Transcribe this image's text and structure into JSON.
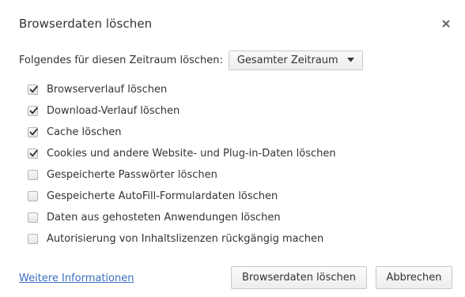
{
  "dialog": {
    "title": "Browserdaten löschen",
    "close_icon": "close-icon"
  },
  "time_range": {
    "label": "Folgendes für diesen Zeitraum löschen:",
    "selected": "Gesamter Zeitraum"
  },
  "options": [
    {
      "label": "Browserverlauf löschen",
      "checked": true
    },
    {
      "label": "Download-Verlauf löschen",
      "checked": true
    },
    {
      "label": "Cache löschen",
      "checked": true
    },
    {
      "label": "Cookies und andere Website- und Plug-in-Daten löschen",
      "checked": true
    },
    {
      "label": "Gespeicherte Passwörter löschen",
      "checked": false
    },
    {
      "label": "Gespeicherte AutoFill-Formulardaten löschen",
      "checked": false
    },
    {
      "label": "Daten aus gehosteten Anwendungen löschen",
      "checked": false
    },
    {
      "label": "Autorisierung von Inhaltslizenzen rückgängig machen",
      "checked": false
    }
  ],
  "footer": {
    "more_info_link": "Weitere Informationen",
    "clear_button": "Browserdaten löschen",
    "cancel_button": "Abbrechen"
  },
  "colors": {
    "link": "#3b6fc4",
    "text": "#333333",
    "check": "#333333"
  }
}
